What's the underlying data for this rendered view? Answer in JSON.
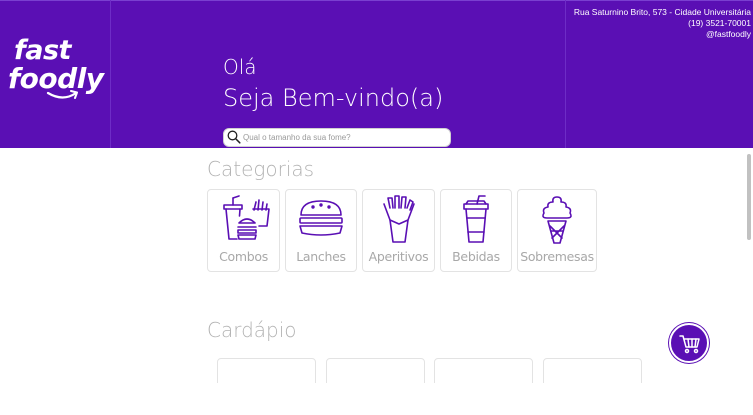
{
  "header": {
    "logo": {
      "line1": "fast",
      "line2": "foodly"
    },
    "contact": {
      "address": "Rua Saturnino Brito, 573 - Cidade Universitária",
      "phone": "(19) 3521-70001",
      "social": "@fastfoodly"
    },
    "greeting": "Olá",
    "welcome": "Seja Bem-vindo(a)"
  },
  "search": {
    "placeholder": "Qual o tamanho da sua fome?",
    "value": "",
    "icon": "search-icon"
  },
  "categories": {
    "title": "Categorias",
    "items": [
      {
        "label": "Combos",
        "icon": "combo-icon"
      },
      {
        "label": "Lanches",
        "icon": "burger-icon"
      },
      {
        "label": "Aperitivos",
        "icon": "fries-icon"
      },
      {
        "label": "Bebidas",
        "icon": "drink-icon"
      },
      {
        "label": "Sobremesas",
        "icon": "ice-cream-icon"
      }
    ]
  },
  "menu": {
    "title": "Cardápio"
  },
  "cart": {
    "icon": "cart-icon"
  },
  "colors": {
    "brand": "#5a0fb4",
    "muted_text": "#b3b3b3",
    "card_border": "#e3e3e3"
  }
}
